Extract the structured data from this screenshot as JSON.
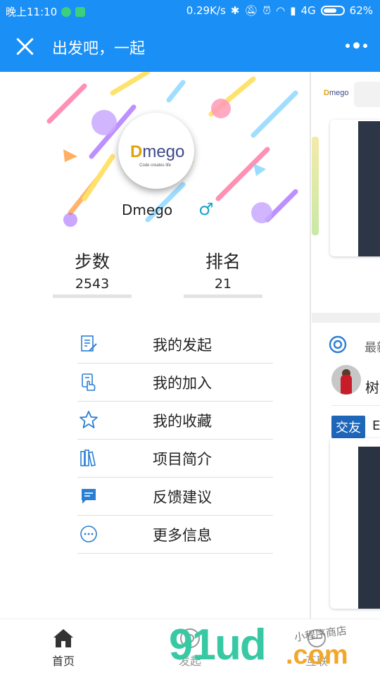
{
  "status_bar": {
    "time": "晚上11:10",
    "speed": "0.29K/s",
    "network": "4G",
    "battery": "62%",
    "battery_level": 0.62
  },
  "header": {
    "title": "出发吧，一起"
  },
  "profile": {
    "logo_main": "mego",
    "logo_letter": "D",
    "logo_tagline": "Code creates life",
    "username": "Dmego",
    "gender_symbol": "♂"
  },
  "stats": [
    {
      "label": "步数",
      "value": "2543"
    },
    {
      "label": "排名",
      "value": "21"
    }
  ],
  "menu": [
    {
      "label": "我的发起",
      "icon": "edit-doc-icon"
    },
    {
      "label": "我的加入",
      "icon": "hand-clipboard-icon"
    },
    {
      "label": "我的收藏",
      "icon": "star-icon"
    },
    {
      "label": "项目简介",
      "icon": "books-icon"
    },
    {
      "label": "反馈建议",
      "icon": "message-icon"
    },
    {
      "label": "更多信息",
      "icon": "more-circle-icon"
    }
  ],
  "peek_panel": {
    "brand_letter": "D",
    "brand_main": "mego",
    "latest_label": "最新",
    "user_name": "树",
    "tag": "交友",
    "tag_text": "E"
  },
  "tabbar": [
    {
      "label": "首页",
      "icon": "home-icon"
    },
    {
      "label": "发起",
      "icon": "launch-icon"
    },
    {
      "label": "互联",
      "icon": "connect-icon"
    }
  ],
  "watermark": {
    "main": "91ud",
    "suffix": ".com",
    "caption": "小程序商店"
  },
  "colors": {
    "primary": "#1a8ff5",
    "icon_blue": "#2a7fd4",
    "tag_blue": "#1d66b8"
  }
}
